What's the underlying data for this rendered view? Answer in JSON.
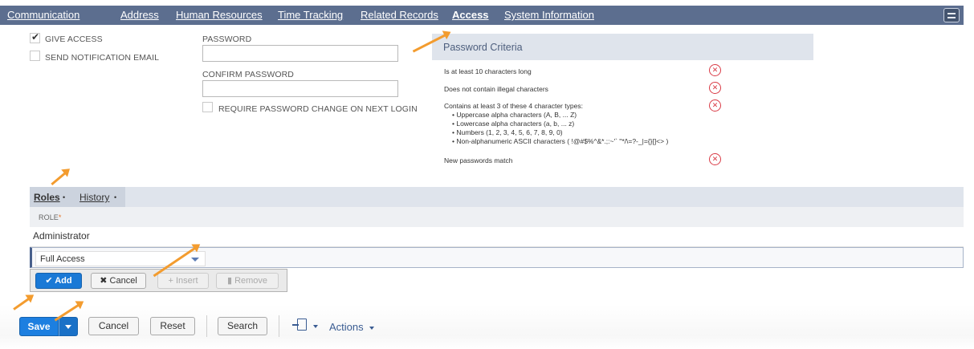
{
  "tabs": [
    {
      "label": "Communication",
      "active": false
    },
    {
      "label": "Address",
      "active": false
    },
    {
      "label": "Human Resources",
      "active": false
    },
    {
      "label": "Time Tracking",
      "active": false
    },
    {
      "label": "Related Records",
      "active": false
    },
    {
      "label": "Access",
      "active": true
    },
    {
      "label": "System Information",
      "active": false
    }
  ],
  "access": {
    "give_access": {
      "label": "GIVE ACCESS",
      "checked": true
    },
    "send_notification": {
      "label": "SEND NOTIFICATION EMAIL",
      "checked": false
    },
    "password_label": "PASSWORD",
    "confirm_password_label": "CONFIRM PASSWORD",
    "require_change": {
      "label": "REQUIRE PASSWORD CHANGE ON NEXT LOGIN",
      "checked": false
    }
  },
  "password_criteria": {
    "title": "Password Criteria",
    "items": [
      {
        "text": "Is at least 10 characters long",
        "met": false
      },
      {
        "text": "Does not contain illegal characters",
        "met": false
      },
      {
        "text": "Contains at least 3 of these 4 character types:",
        "met": false
      },
      {
        "text": "New passwords match",
        "met": false
      }
    ],
    "char_types": [
      "• Uppercase alpha characters (A, B, ... Z)",
      "• Lowercase alpha characters (a, b, ... z)",
      "• Numbers (1, 2, 3, 4, 5, 6, 7, 8, 9, 0)",
      "• Non-alphanumeric ASCII characters ( !@#$%^&*.;:~'` \"*/\\=?-_|={}[]<> )"
    ],
    "fail_icon": "x-circle-icon",
    "fail_color": "#d93a45"
  },
  "subtabs": [
    {
      "label": "Roles",
      "dot": "•",
      "active": true
    },
    {
      "label": "History",
      "dot": "•",
      "active": false
    }
  ],
  "roles": {
    "column_header": "ROLE",
    "required_mark": "*",
    "rows": [
      "Administrator"
    ],
    "edit_value": "Full Access",
    "buttons": {
      "add": "Add",
      "cancel": "Cancel",
      "insert": "Insert",
      "remove": "Remove"
    }
  },
  "footer": {
    "save": "Save",
    "cancel": "Cancel",
    "reset": "Reset",
    "search": "Search",
    "actions": "Actions",
    "new_record_icon": "new-document-icon"
  },
  "colors": {
    "tabbar": "#5c6e8f",
    "primary": "#1a79d6",
    "annotation_arrow": "#f39c2f"
  }
}
